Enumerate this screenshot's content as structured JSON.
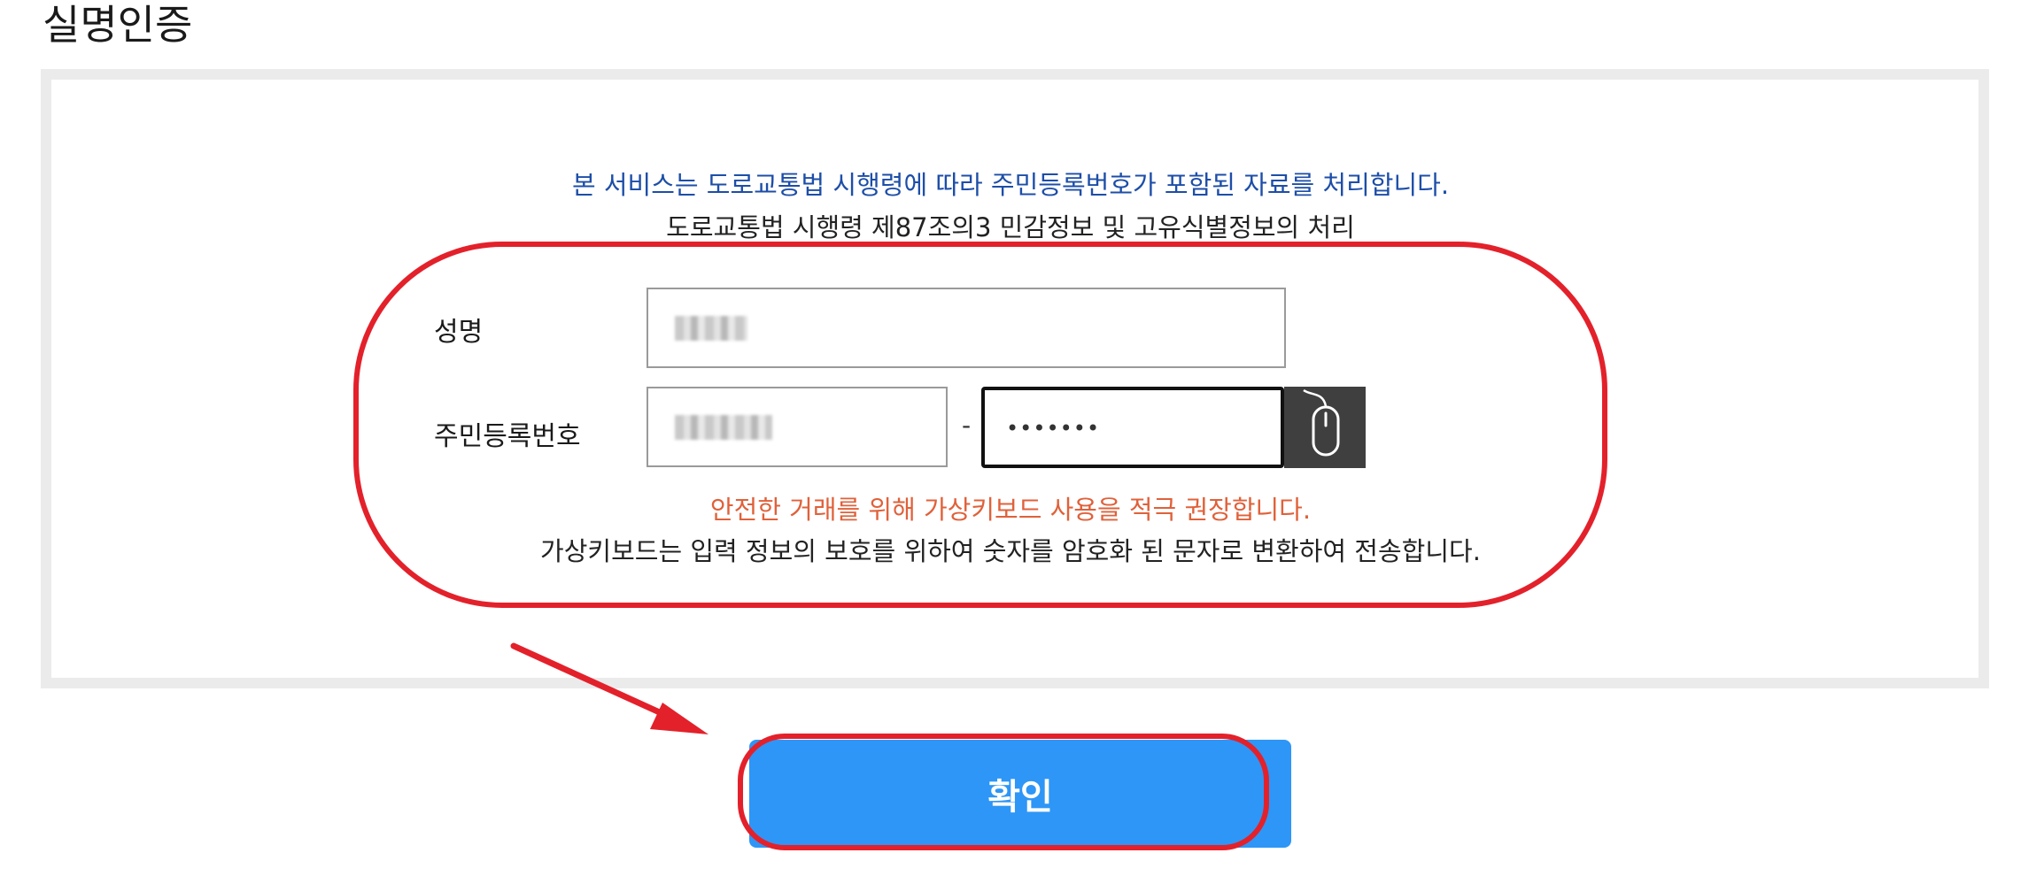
{
  "page": {
    "title": "실명인증"
  },
  "notice": {
    "main": "본 서비스는 도로교통법 시행령에 따라 주민등록번호가 포함된 자료를 처리합니다.",
    "sub": "도로교통법 시행령 제87조의3 민감정보 및 고유식별정보의 처리"
  },
  "form": {
    "name_label": "성명",
    "rrn_label": "주민등록번호",
    "dash": "-",
    "rrn_back_value": "•••••••",
    "virtual_keyboard_icon": "mouse-icon",
    "warning": "안전한 거래를 위해 가상키보드 사용을 적극 권장합니다.",
    "info": "가상키보드는 입력 정보의 보호를 위하여 숫자를 암호화 된 문자로 변환하여 전송합니다."
  },
  "actions": {
    "confirm_label": "확인"
  },
  "colors": {
    "notice_blue": "#1d4ea8",
    "warning_orange": "#e0613a",
    "button_blue": "#2e96f6",
    "annotation_red": "#e3212b"
  }
}
